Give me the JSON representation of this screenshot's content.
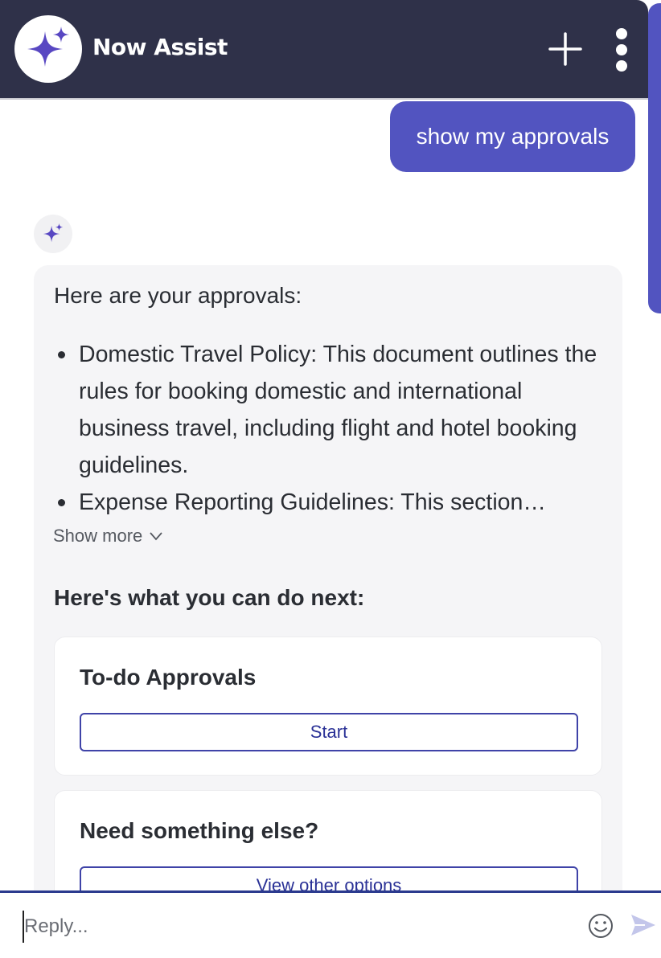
{
  "header": {
    "title": "Now Assist",
    "logo_icon": "sparkle-icon",
    "new_chat_icon": "plus-icon",
    "menu_icon": "kebab-menu-icon",
    "bg_color": "#2f3149"
  },
  "user_message": {
    "text": "show my approvals",
    "bubble_color": "#5254c0"
  },
  "bot_message": {
    "intro": "Here are your approvals:",
    "items": [
      {
        "text": "Domestic Travel Policy: This document outlines the rules for booking domestic and international business travel, including flight and hotel booking guidelines."
      },
      {
        "text": "Expense Reporting Guidelines: This section…"
      }
    ],
    "show_more_label": "Show more",
    "next_heading": "Here's what you can do next:",
    "actions": [
      {
        "title": "To-do Approvals",
        "button_label": "Start"
      },
      {
        "title": "Need something else?",
        "button_label": "View other options"
      }
    ]
  },
  "composer": {
    "placeholder": "Reply...",
    "emoji_icon": "emoji-icon",
    "send_icon": "send-icon"
  }
}
